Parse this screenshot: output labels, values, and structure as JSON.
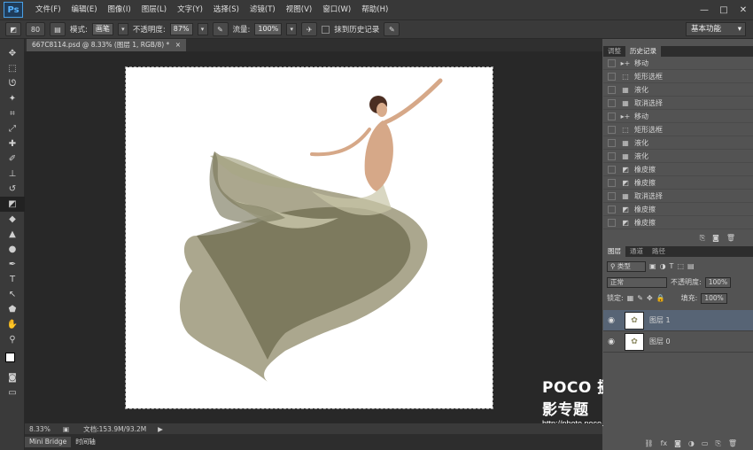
{
  "app": {
    "logo": "Ps"
  },
  "menu": [
    "文件(F)",
    "编辑(E)",
    "图像(I)",
    "图层(L)",
    "文字(Y)",
    "选择(S)",
    "滤镜(T)",
    "视图(V)",
    "窗口(W)",
    "帮助(H)"
  ],
  "window_controls": [
    "—",
    "□",
    "✕"
  ],
  "options_bar": {
    "brush_size": "80",
    "mode_label": "模式:",
    "mode_value": "画笔",
    "opacity_label": "不透明度:",
    "opacity_value": "87%",
    "flow_label": "流量:",
    "flow_value": "100%",
    "history_label": "抹到历史记录",
    "workspace": "基本功能"
  },
  "document": {
    "tab_title": "667C8114.psd @ 8.33% (图层 1, RGB/8) *",
    "zoom": "8.33%",
    "doc_info": "文档:153.9M/93.2M"
  },
  "bottom_tabs": [
    "Mini Bridge",
    "时间轴"
  ],
  "history_panel": {
    "tabs": [
      "调整",
      "历史记录"
    ],
    "items": [
      {
        "icon": "move-icon",
        "glyph": "▸+",
        "label": "移动"
      },
      {
        "icon": "marquee-icon",
        "glyph": "⬚",
        "label": "矩形选框"
      },
      {
        "icon": "doc-icon",
        "glyph": "▦",
        "label": "液化"
      },
      {
        "icon": "doc-icon",
        "glyph": "▦",
        "label": "取消选择"
      },
      {
        "icon": "move-icon",
        "glyph": "▸+",
        "label": "移动"
      },
      {
        "icon": "marquee-icon",
        "glyph": "⬚",
        "label": "矩形选框"
      },
      {
        "icon": "doc-icon",
        "glyph": "▦",
        "label": "液化"
      },
      {
        "icon": "doc-icon",
        "glyph": "▦",
        "label": "液化"
      },
      {
        "icon": "eraser-icon",
        "glyph": "◩",
        "label": "橡皮擦"
      },
      {
        "icon": "eraser-icon",
        "glyph": "◩",
        "label": "橡皮擦"
      },
      {
        "icon": "doc-icon",
        "glyph": "▦",
        "label": "取消选择"
      },
      {
        "icon": "eraser-icon",
        "glyph": "◩",
        "label": "橡皮擦"
      },
      {
        "icon": "eraser-icon",
        "glyph": "◩",
        "label": "橡皮擦"
      }
    ]
  },
  "layers_panel": {
    "tabs": [
      "图层",
      "通道",
      "路径"
    ],
    "filter": "类型",
    "blend_mode": "正常",
    "opacity_label": "不透明度:",
    "opacity_value": "100%",
    "lock_label": "锁定:",
    "fill_label": "填充:",
    "fill_value": "100%",
    "layers": [
      {
        "name": "图层 1",
        "selected": true
      },
      {
        "name": "图层 0",
        "selected": false
      }
    ]
  },
  "watermark": {
    "title": "POCO 摄影专题",
    "url": "http://photo.poco.cn/"
  }
}
